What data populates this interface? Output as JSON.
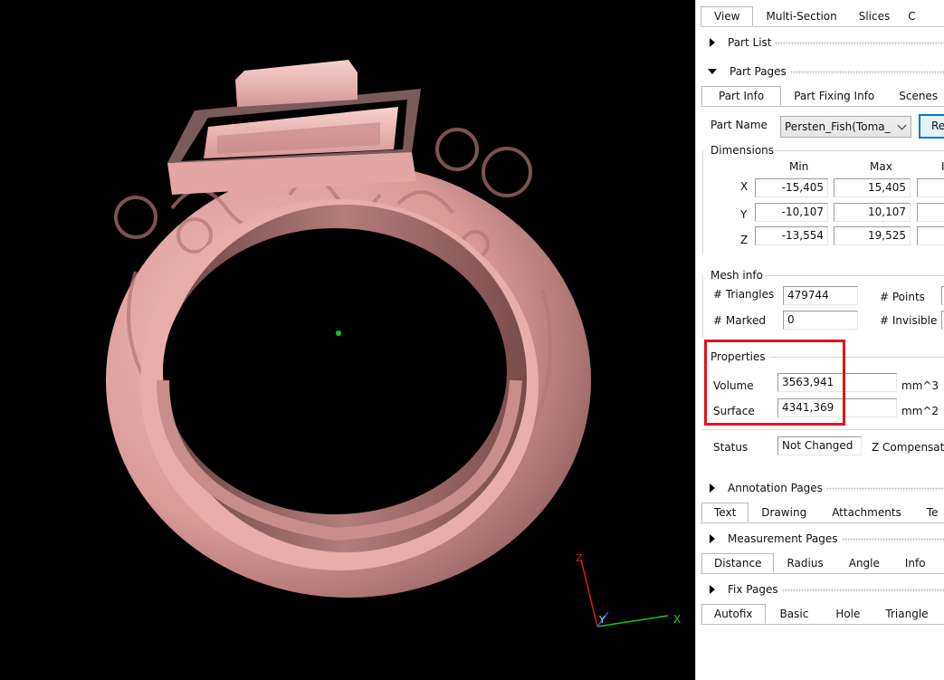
{
  "top_tabs": [
    {
      "label": "View",
      "active": true
    },
    {
      "label": "Multi-Section",
      "active": false
    },
    {
      "label": "Slices",
      "active": false
    },
    {
      "label": "C",
      "active": false
    }
  ],
  "part_list": {
    "label": "Part List"
  },
  "part_pages": {
    "label": "Part Pages",
    "tabs": [
      {
        "label": "Part Info",
        "active": true
      },
      {
        "label": "Part Fixing Info",
        "active": false
      },
      {
        "label": "Scenes",
        "active": false
      }
    ],
    "part_name_label": "Part Name",
    "part_name_value": "Persten_Fish(Toma_",
    "reset_button": "Re",
    "dimensions": {
      "title": "Dimensions",
      "col_min": "Min",
      "col_max": "Max",
      "col_extra": "I",
      "rows": [
        {
          "axis": "X",
          "min": "-15,405",
          "max": "15,405"
        },
        {
          "axis": "Y",
          "min": "-10,107",
          "max": "10,107"
        },
        {
          "axis": "Z",
          "min": "-13,554",
          "max": "19,525"
        }
      ]
    },
    "mesh_info": {
      "title": "Mesh info",
      "triangles_label": "# Triangles",
      "triangles_value": "479744",
      "points_label": "# Points",
      "marked_label": "# Marked",
      "marked_value": "0",
      "invisible_label": "# Invisible"
    },
    "properties": {
      "title": "Properties",
      "volume_label": "Volume",
      "volume_value": "3563,941",
      "volume_unit": "mm^3",
      "surface_label": "Surface",
      "surface_value": "4341,369",
      "surface_unit": "mm^2"
    },
    "status": {
      "label": "Status",
      "value": "Not Changed",
      "z_comp_label": "Z Compensate"
    }
  },
  "annotation_pages": {
    "label": "Annotation Pages",
    "tabs": [
      {
        "label": "Text",
        "active": true
      },
      {
        "label": "Drawing",
        "active": false
      },
      {
        "label": "Attachments",
        "active": false
      },
      {
        "label": "Te",
        "active": false
      }
    ]
  },
  "measurement_pages": {
    "label": "Measurement Pages",
    "tabs": [
      {
        "label": "Distance",
        "active": true
      },
      {
        "label": "Radius",
        "active": false
      },
      {
        "label": "Angle",
        "active": false
      },
      {
        "label": "Info",
        "active": false
      }
    ]
  },
  "fix_pages": {
    "label": "Fix Pages",
    "tabs": [
      {
        "label": "Autofix",
        "active": true
      },
      {
        "label": "Basic",
        "active": false
      },
      {
        "label": "Hole",
        "active": false
      },
      {
        "label": "Triangle",
        "active": false
      }
    ]
  },
  "axes": {
    "z": "Z",
    "y": "Y",
    "x": "X"
  },
  "colors": {
    "model": "#e7a7a7",
    "highlight": "#e0141e",
    "tab_border": "#b9b9b9"
  }
}
